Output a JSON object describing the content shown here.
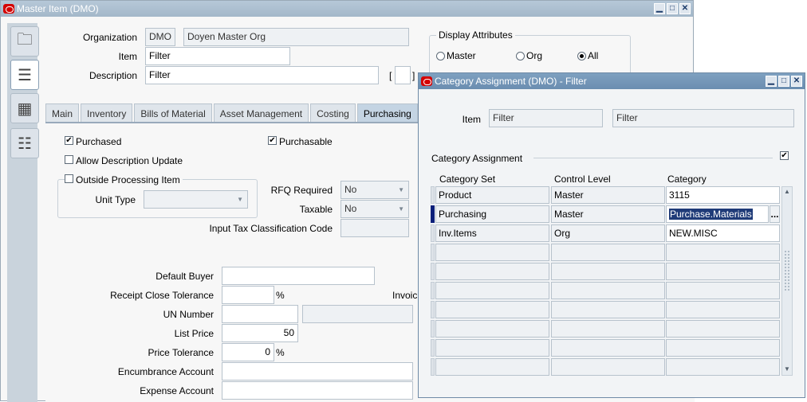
{
  "master": {
    "title": "Master Item (DMO)",
    "organization_label": "Organization",
    "organization_code": "DMO",
    "organization_name": "Doyen Master Org",
    "item_label": "Item",
    "item_value": "Filter",
    "description_label": "Description",
    "description_value": "Filter",
    "bracket_left": "[",
    "bracket_right": "]",
    "display_attributes": {
      "title": "Display Attributes",
      "options": [
        "Master",
        "Org",
        "All"
      ],
      "selected": "All"
    },
    "tabs": [
      "Main",
      "Inventory",
      "Bills of Material",
      "Asset Management",
      "Costing",
      "Purchasing"
    ],
    "active_tab": "Purchasing",
    "purchasing": {
      "purchased_label": "Purchased",
      "purchased": true,
      "purchasable_label": "Purchasable",
      "purchasable": true,
      "allow_desc_update_label": "Allow Description Update",
      "outside_processing_label": "Outside Processing Item",
      "unit_type_label": "Unit Type",
      "unit_type_value": "",
      "rfq_required_label": "RFQ Required",
      "rfq_required_value": "No",
      "taxable_label": "Taxable",
      "taxable_value": "No",
      "input_tax_label": "Input Tax Classification Code",
      "default_buyer_label": "Default Buyer",
      "receipt_close_label": "Receipt Close Tolerance",
      "percent": "%",
      "invoice_partial_label": "Invoic",
      "un_number_label": "UN Number",
      "list_price_label": "List Price",
      "list_price_value": "50",
      "price_tolerance_label": "Price Tolerance",
      "price_tolerance_value": "0",
      "encumbrance_label": "Encumbrance Account",
      "expense_label": "Expense Account"
    }
  },
  "category_window": {
    "title": "Category Assignment (DMO) - Filter",
    "item_label": "Item",
    "item_value": "Filter",
    "item_desc": "Filter",
    "section_label": "Category Assignment",
    "columns": [
      "Category Set",
      "Control Level",
      "Category"
    ],
    "rows": [
      {
        "set": "Product",
        "level": "Master",
        "category": "3115"
      },
      {
        "set": "Purchasing",
        "level": "Master",
        "category": "Purchase.Materials"
      },
      {
        "set": "Inv.Items",
        "level": "Org",
        "category": "NEW.MISC"
      }
    ],
    "ellipsis": "..."
  }
}
